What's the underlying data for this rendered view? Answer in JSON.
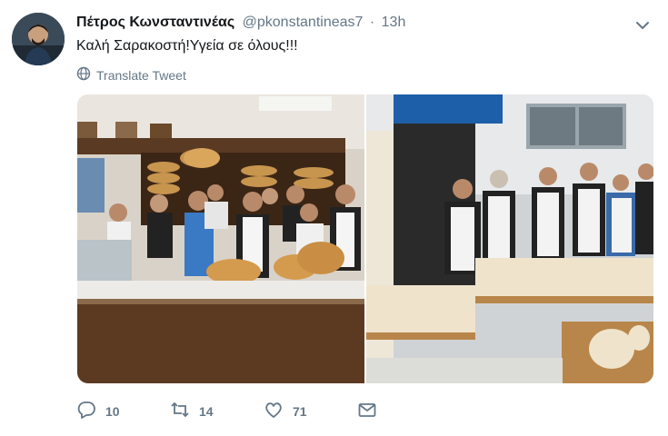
{
  "tweet": {
    "author_name": "Πέτρος Κωνσταντινέας",
    "handle": "@pkonstantineas7",
    "separator": "·",
    "time": "13h",
    "text": "Καλή Σαρακοστή!Υγεία σε όλους!!!",
    "translate_label": "Translate Tweet"
  },
  "stats": {
    "replies": "10",
    "retweets": "14",
    "likes": "71"
  },
  "icons": {
    "caret": "chevron-down-icon",
    "translate": "globe-icon",
    "reply": "reply-icon",
    "retweet": "retweet-icon",
    "like": "heart-icon",
    "message": "envelope-icon"
  },
  "colors": {
    "text": "#14171a",
    "secondary": "#657786"
  }
}
